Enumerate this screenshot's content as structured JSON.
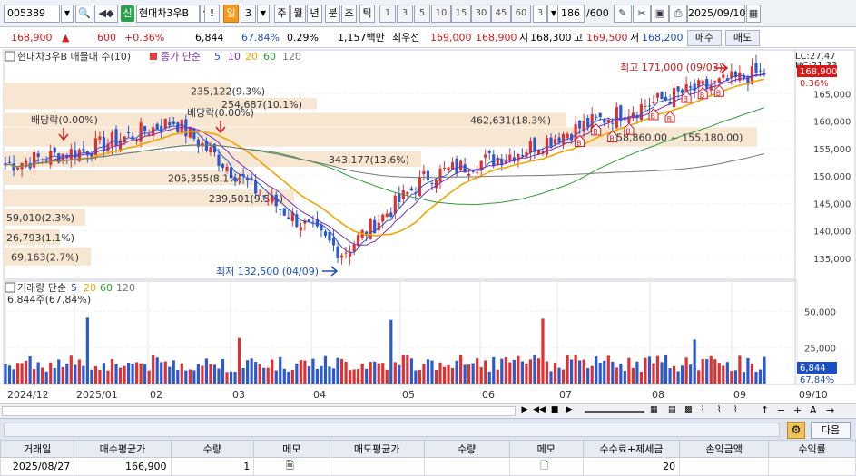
{
  "toolbar": {
    "code": "005389",
    "badge": "신",
    "name": "현대차3우B",
    "warn": "!",
    "period_active": "일",
    "period_num": "3",
    "periods": [
      "주",
      "월",
      "년",
      "분",
      "초",
      "틱"
    ],
    "nums": [
      "1",
      "3",
      "5",
      "10",
      "15",
      "30",
      "45",
      "60"
    ],
    "sub_num": "3",
    "count": "186",
    "count_total": "/600",
    "date": "2025/09/10"
  },
  "pricebar": {
    "price": "168,900",
    "arrow": "▲",
    "change": "600",
    "change_pct": "+0.36%",
    "volume": "6,844",
    "volume_ratio": "67.84%",
    "turnover": "0.29%",
    "amount": "1,157백만",
    "best_label": "최우선",
    "ask": "169,000",
    "bid": "168,900",
    "open_label": "시",
    "open": "168,300",
    "high_label": "고",
    "high": "169,500",
    "low_label": "저",
    "low": "168,200",
    "buy": "매수",
    "sell": "매도"
  },
  "chart": {
    "legend_name": "현대차3우B 매물대 수(10)",
    "legend_price": "종가 단순",
    "ma_labels": [
      "5",
      "10",
      "20",
      "60",
      "120"
    ],
    "ma_colors": [
      "#2b54d6",
      "#7a2fb5",
      "#f0a500",
      "#2e9e3a",
      "#777777"
    ],
    "lc_label": "LC:27.47",
    "hc_label": "HC:21.33",
    "price_tag": "168,900",
    "price_tag_pct": "0.36%",
    "high_label": "최고 171,000 (09/03)",
    "low_label": "최저 132,500 (04/09)",
    "dividend_labels": [
      "배당락(0.00%)",
      "배당락(0.00%)"
    ],
    "buy_marker": "B",
    "volume_profile": [
      {
        "label": "235,122(9.3%)"
      },
      {
        "label": "254,687(10.1%)"
      },
      {
        "label": "462,631(18.3%)"
      },
      {
        "label": "158,860.00 ~ 155,180.00)"
      },
      {
        "label": "343,177(13.6%)"
      },
      {
        "label": "205,355(8.1%)"
      },
      {
        "label": "239,501(9.5%)"
      },
      {
        "label": "59,010(2.3%)"
      },
      {
        "label": "26,793(1.1%)"
      },
      {
        "label": "69,163(2.7%)"
      }
    ],
    "y_ticks": [
      "165,000",
      "160,000",
      "155,000",
      "150,000",
      "145,000",
      "140,000",
      "135,000"
    ],
    "vol_legend": "거래량 단순",
    "vol_ma_labels": [
      "5",
      "20",
      "60",
      "120"
    ],
    "vol_sub": "6,844주(67,84%)",
    "vol_ticks": [
      "50,000",
      "25,000"
    ],
    "vol_tag": "6,844",
    "vol_tag_pct": "67.84%",
    "x_labels": [
      "2024/12",
      "2025/01",
      "02",
      "03",
      "04",
      "05",
      "06",
      "07",
      "08",
      "09",
      "09/10"
    ]
  },
  "subbar": {
    "next": "다음"
  },
  "table": {
    "headers": [
      "거래일",
      "매수평균가",
      "수량",
      "메모",
      "매도평균가",
      "수량",
      "메모",
      "수수료+제세금",
      "손익금액",
      "수익률"
    ],
    "row": [
      "2025/08/27",
      "166,900",
      "1",
      "",
      "",
      "",
      "",
      "20",
      "",
      ""
    ]
  },
  "chart_data": {
    "type": "line",
    "title": "현대차3우B",
    "x": [
      "2024/12",
      "2025/01",
      "02",
      "03",
      "04",
      "05",
      "06",
      "07",
      "08",
      "09"
    ],
    "series": [
      {
        "name": "종가",
        "values": [
          152000,
          155000,
          160000,
          147000,
          136000,
          150000,
          154000,
          160000,
          165000,
          168900
        ]
      }
    ],
    "ylim": [
      132000,
      172000
    ]
  }
}
